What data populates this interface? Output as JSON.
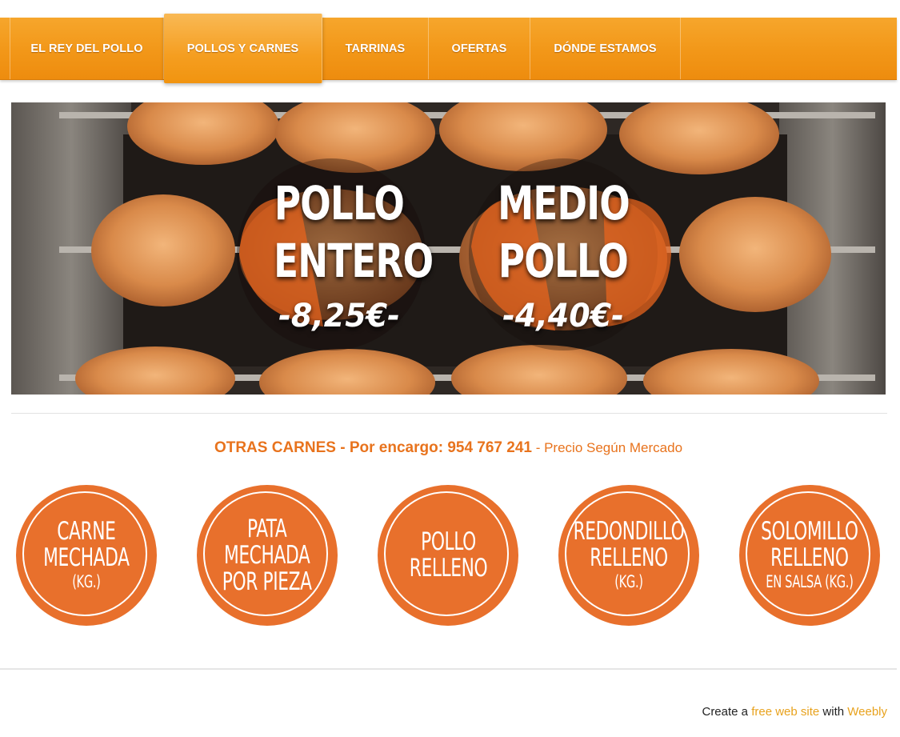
{
  "nav": {
    "items": [
      {
        "label": "EL REY DEL POLLO",
        "active": false
      },
      {
        "label": "POLLOS Y CARNES",
        "active": true
      },
      {
        "label": "TARRINAS",
        "active": false
      },
      {
        "label": "OFERTAS",
        "active": false
      },
      {
        "label": "DÓNDE ESTAMOS",
        "active": false
      }
    ]
  },
  "hero": {
    "left": {
      "line1": "POLLO",
      "line2": "ENTERO",
      "price": "-8,25€-"
    },
    "right": {
      "line1": "MEDIO",
      "line2": "POLLO",
      "price": "-4,40€-"
    }
  },
  "otras": {
    "heading": "OTRAS CARNES - Por encargo: 954 767 241",
    "sub": " - Precio Según Mercado"
  },
  "products": [
    {
      "lines": [
        "Carne",
        "Mechada"
      ],
      "small": "(kg.)"
    },
    {
      "lines": [
        "Pata",
        "Mechada",
        "por Pieza"
      ],
      "small": ""
    },
    {
      "lines": [
        "Pollo",
        "Relleno"
      ],
      "small": ""
    },
    {
      "lines": [
        "Redondillo",
        "Relleno"
      ],
      "small": "(kg.)"
    },
    {
      "lines": [
        "Solomillo",
        "Relleno"
      ],
      "small": "en Salsa (kg.)"
    }
  ],
  "footer": {
    "prefix": "Create a ",
    "link1": "free web site",
    "mid": " with ",
    "link2": "Weebly"
  },
  "colors": {
    "nav_orange": "#f29718",
    "accent_orange": "#e8702c",
    "text_orange": "#e8731d",
    "link_gold": "#e8a21d"
  }
}
